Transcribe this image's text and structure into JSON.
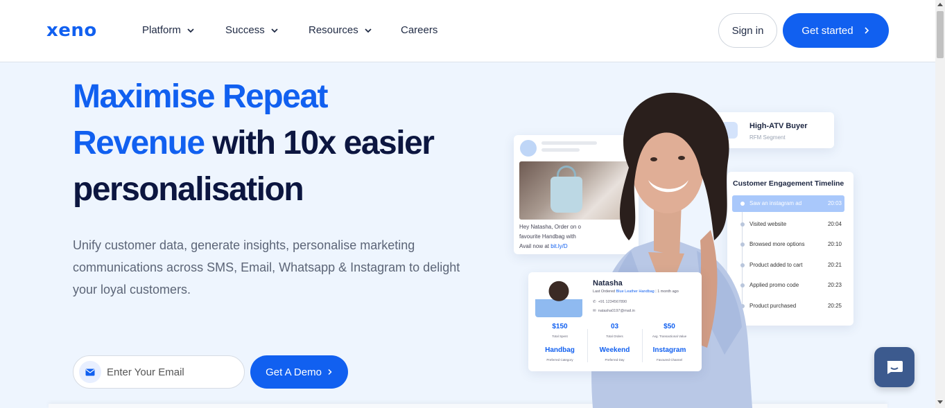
{
  "header": {
    "logo": "xeno",
    "nav": [
      {
        "label": "Platform",
        "has_dropdown": true
      },
      {
        "label": "Success",
        "has_dropdown": true
      },
      {
        "label": "Resources",
        "has_dropdown": true
      },
      {
        "label": "Careers",
        "has_dropdown": false
      }
    ],
    "sign_in": "Sign in",
    "get_started": "Get started"
  },
  "hero": {
    "title_blue_1": "Maximise Repeat",
    "title_blue_2": "Revenue",
    "title_dark_1": " with 10x easier",
    "title_dark_2": "personalisation",
    "subtitle": "Unify customer data, generate insights, personalise marketing communications across SMS, Email, Whatsapp & Instagram to delight your loyal customers.",
    "email_placeholder": "Enter Your Email",
    "demo_button": "Get A Demo"
  },
  "illustration": {
    "message": {
      "line1": "Hey Natasha, Order on o",
      "line2": "favourite Handbag with",
      "line3_prefix": "Avail now at ",
      "link": "bit.ly/D"
    },
    "segment": {
      "title": "High-ATV Buyer",
      "subtitle": "RFM Segment"
    },
    "timeline": {
      "title": "Customer Engagement Timeline",
      "events": [
        {
          "label": "Saw an instagram ad",
          "time": "20:03",
          "active": true
        },
        {
          "label": "Visited website",
          "time": "20:04"
        },
        {
          "label": "Browsed more options",
          "time": "20:10"
        },
        {
          "label": "Product added to cart",
          "time": "20:21"
        },
        {
          "label": "Applied promo code",
          "time": "20:23"
        },
        {
          "label": "Product purchased",
          "time": "20:25"
        }
      ]
    },
    "profile": {
      "name": "Natasha",
      "last_ordered_prefix": "Last Ordered",
      "last_ordered_item": "Blue Leather Handbag",
      "last_ordered_when": "1 month ago",
      "phone": "+91 1234567890",
      "email": "natasha0197@mail.in",
      "stats": [
        {
          "value": "$150",
          "label": "Total Spent"
        },
        {
          "value": "03",
          "label": "Total Orders"
        },
        {
          "value": "$50",
          "label": "Avg. Transactional Value"
        },
        {
          "value": "Handbag",
          "label": "Preferred Category"
        },
        {
          "value": "Weekend",
          "label": "Preferred Day"
        },
        {
          "value": "Instagram",
          "label": "Favoured Channel"
        }
      ]
    }
  },
  "colors": {
    "brand": "#1160f0",
    "heading": "#0c1640",
    "background": "#eef5fe",
    "chat": "#3c5a8e"
  },
  "icons": [
    "chevron-down-icon",
    "chevron-right-icon",
    "mail-icon",
    "phone-icon",
    "chat-icon"
  ]
}
